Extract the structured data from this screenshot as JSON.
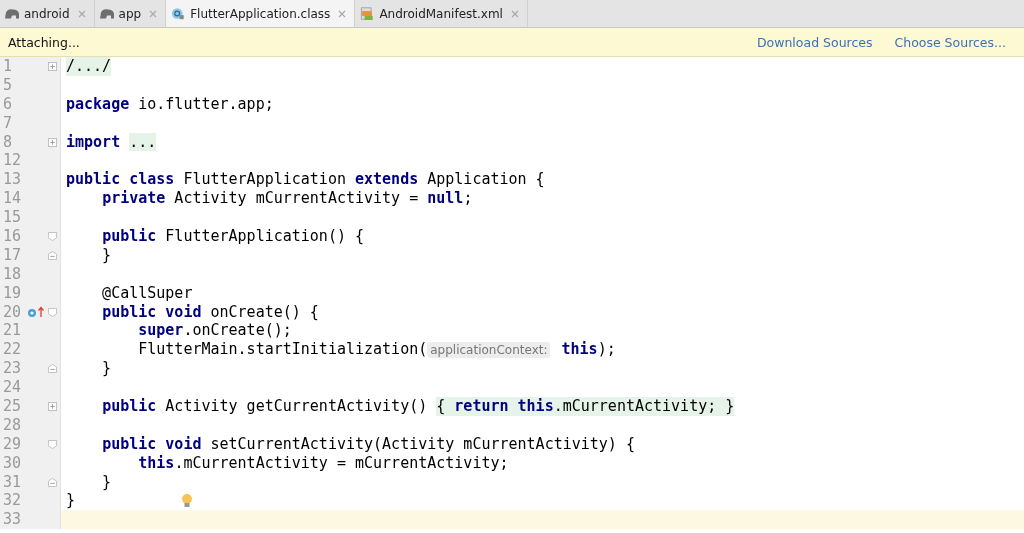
{
  "tabs": [
    {
      "label": "android",
      "kind": "gradle",
      "selected": false
    },
    {
      "label": "app",
      "kind": "gradle",
      "selected": false
    },
    {
      "label": "FlutterApplication.class",
      "kind": "class",
      "selected": true
    },
    {
      "label": "AndroidManifest.xml",
      "kind": "xml",
      "selected": false
    }
  ],
  "banner": {
    "message": "Attaching...",
    "links": [
      "Download Sources",
      "Choose Sources..."
    ]
  },
  "lines": [
    {
      "n": "1",
      "kind": "collapsed",
      "folded": "/.../"
    },
    {
      "n": "5",
      "kind": "plain"
    },
    {
      "n": "6",
      "kind": "plain",
      "code": "**package** io.flutter.app;"
    },
    {
      "n": "7",
      "kind": "plain"
    },
    {
      "n": "8",
      "kind": "collapsed",
      "code": "**import** ",
      "folded": "..."
    },
    {
      "n": "12",
      "kind": "plain"
    },
    {
      "n": "13",
      "kind": "plain",
      "code": "**public class** FlutterApplication **extends** Application {"
    },
    {
      "n": "14",
      "kind": "plain",
      "code": "    **private** Activity mCurrentActivity = **null**;"
    },
    {
      "n": "15",
      "kind": "plain"
    },
    {
      "n": "16",
      "kind": "fold-start",
      "code": "    **public** FlutterApplication() {"
    },
    {
      "n": "17",
      "kind": "fold-end",
      "code": "    }"
    },
    {
      "n": "18",
      "kind": "plain"
    },
    {
      "n": "19",
      "kind": "plain",
      "code": "    @CallSuper"
    },
    {
      "n": "20",
      "kind": "fold-start",
      "override": true,
      "code": "    **public void** onCreate() {"
    },
    {
      "n": "21",
      "kind": "plain",
      "code": "        **super**.onCreate();"
    },
    {
      "n": "22",
      "kind": "plain",
      "code": "        FlutterMain.startInitialization(",
      "hint": "applicationContext:",
      "tail": " **this**);"
    },
    {
      "n": "23",
      "kind": "fold-end",
      "code": "    }"
    },
    {
      "n": "24",
      "kind": "plain"
    },
    {
      "n": "25",
      "kind": "collapsed",
      "code": "    **public** Activity getCurrentActivity() ",
      "folded": "{ **return this**.mCurrentActivity; }"
    },
    {
      "n": "28",
      "kind": "plain"
    },
    {
      "n": "29",
      "kind": "fold-start",
      "code": "    **public void** setCurrentActivity(Activity mCurrentActivity) {"
    },
    {
      "n": "30",
      "kind": "plain",
      "code": "        **this**.mCurrentActivity = mCurrentActivity;"
    },
    {
      "n": "31",
      "kind": "fold-end",
      "code": "    }"
    },
    {
      "n": "32",
      "kind": "plain",
      "bulb": true,
      "code": "}"
    },
    {
      "n": "33",
      "kind": "plain",
      "current": true
    }
  ]
}
